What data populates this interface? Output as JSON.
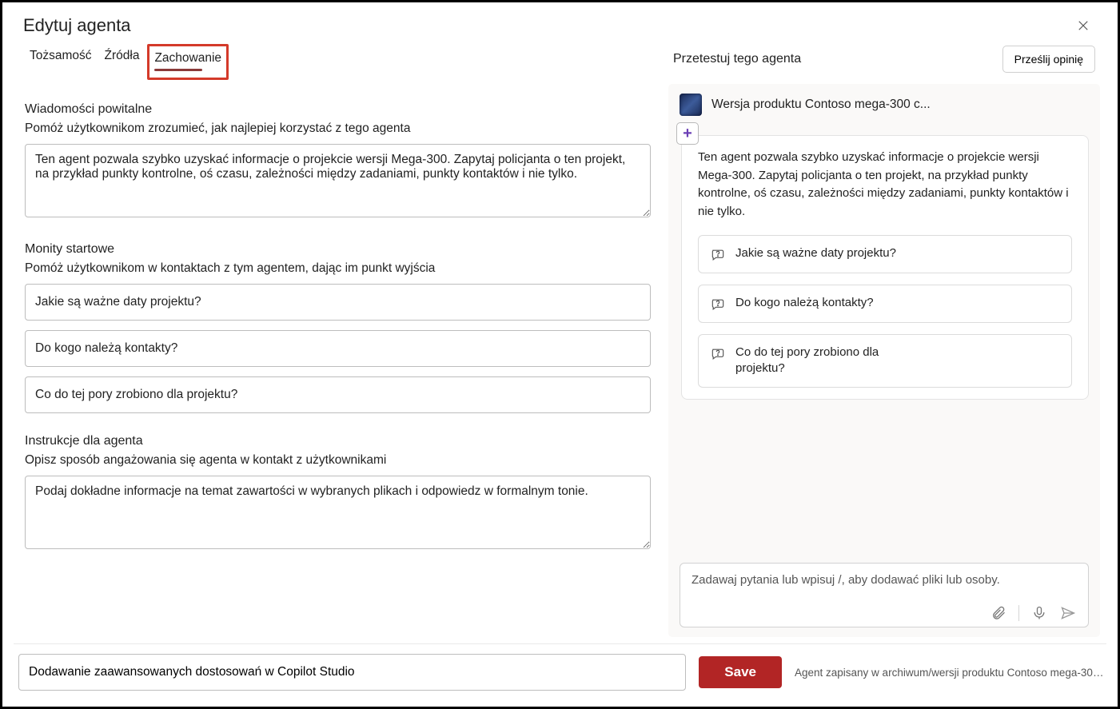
{
  "header": {
    "title": "Edytuj agenta"
  },
  "tabs": {
    "identity": "Tożsamość",
    "sources": "Źródła",
    "behavior": "Zachowanie"
  },
  "welcome": {
    "title": "Wiadomości powitalne",
    "help": "Pomóż użytkownikom zrozumieć, jak najlepiej korzystać z tego agenta",
    "text": "Ten agent pozwala szybko uzyskać informacje o projekcie wersji Mega-300. Zapytaj policjanta o ten projekt, na przykład punkty kontrolne, oś czasu, zależności między zadaniami, punkty kontaktów i nie tylko."
  },
  "starters": {
    "title": "Monity startowe",
    "help": "Pomóż użytkownikom w kontaktach z tym agentem, dając im punkt wyjścia",
    "items": [
      "Jakie są ważne daty projektu?",
      "Do kogo należą kontakty?",
      "Co do tej pory zrobiono dla projektu?"
    ]
  },
  "instructions": {
    "title": "Instrukcje dla agenta",
    "help": "Opisz sposób angażowania się agenta w kontakt z użytkownikami",
    "text": "Podaj dokładne informacje na temat zawartości w wybranych plikach i odpowiedz w formalnym tonie."
  },
  "footer": {
    "advanced": "Dodawanie zaawansowanych dostosowań w Copilot Studio",
    "save": "Save",
    "status": "Agent zapisany w archiwum/wersji produktu Contoso mega-300..."
  },
  "test": {
    "title": "Przetestuj tego agenta",
    "feedback": "Prześlij opinię",
    "agent_name": "Wersja produktu Contoso mega-300 c...",
    "bubble": "Ten agent pozwala szybko uzyskać informacje o projekcie wersji Mega-300. Zapytaj policjanta o ten projekt, na przykład punkty kontrolne, oś czasu, zależności między zadaniami, punkty kontaktów i nie tylko.",
    "cards": [
      "Jakie są ważne daty projektu?",
      "Do kogo należą kontakty?",
      "Co do tej pory zrobiono dla projektu?"
    ],
    "input_placeholder": "Zadawaj pytania lub wpisuj /, aby dodawać pliki lub osoby."
  }
}
